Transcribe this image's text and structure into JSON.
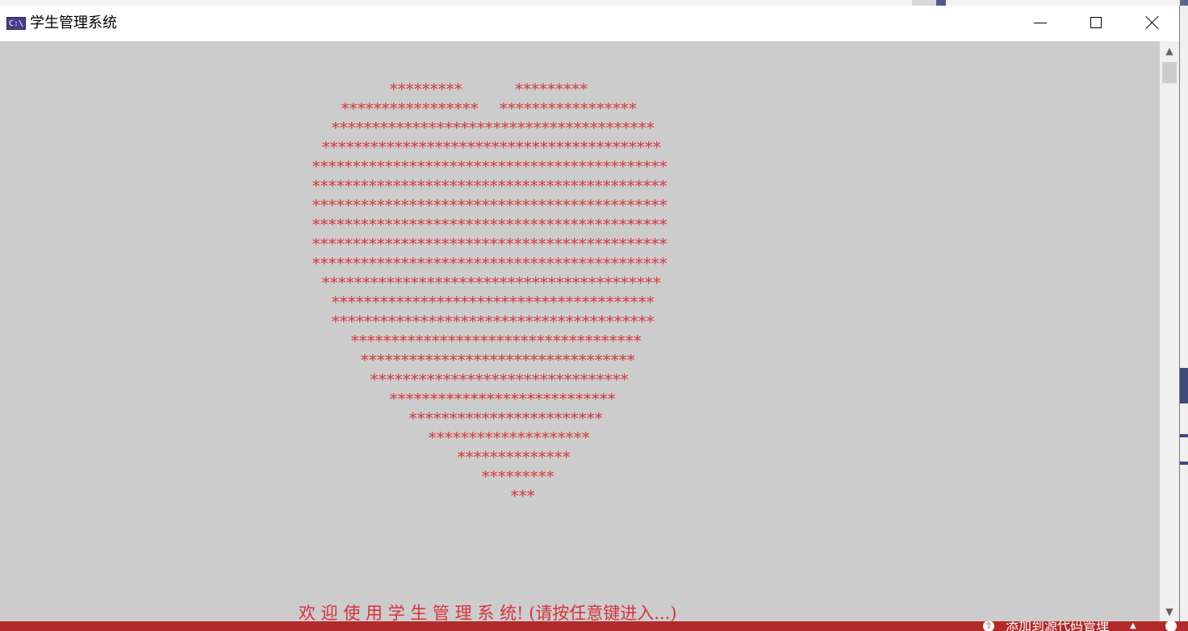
{
  "window": {
    "title": "学生管理系统",
    "icon_label": "C:\\",
    "controls": [
      "minimize-icon",
      "maximize-icon",
      "close-icon"
    ]
  },
  "console": {
    "heart_lines": [
      "*********          *********",
      "*****************    *****************",
      "****************************************",
      "******************************************",
      "********************************************",
      "********************************************",
      "********************************************",
      "********************************************",
      "********************************************",
      "********************************************",
      "******************************************",
      "****************************************",
      "****************************************",
      "************************************",
      "**********************************",
      "********************************",
      "****************************",
      "************************",
      "********************",
      "**************",
      "*********",
      "***"
    ],
    "welcome": "欢 迎 使 用 学 生 管 理 系 统! (请按任意键进入...)",
    "text_color": "#d6323c",
    "background_color": "#cccccc"
  },
  "status_bar": {
    "text": "添加到源代码管理",
    "color": "#b22a2a"
  }
}
